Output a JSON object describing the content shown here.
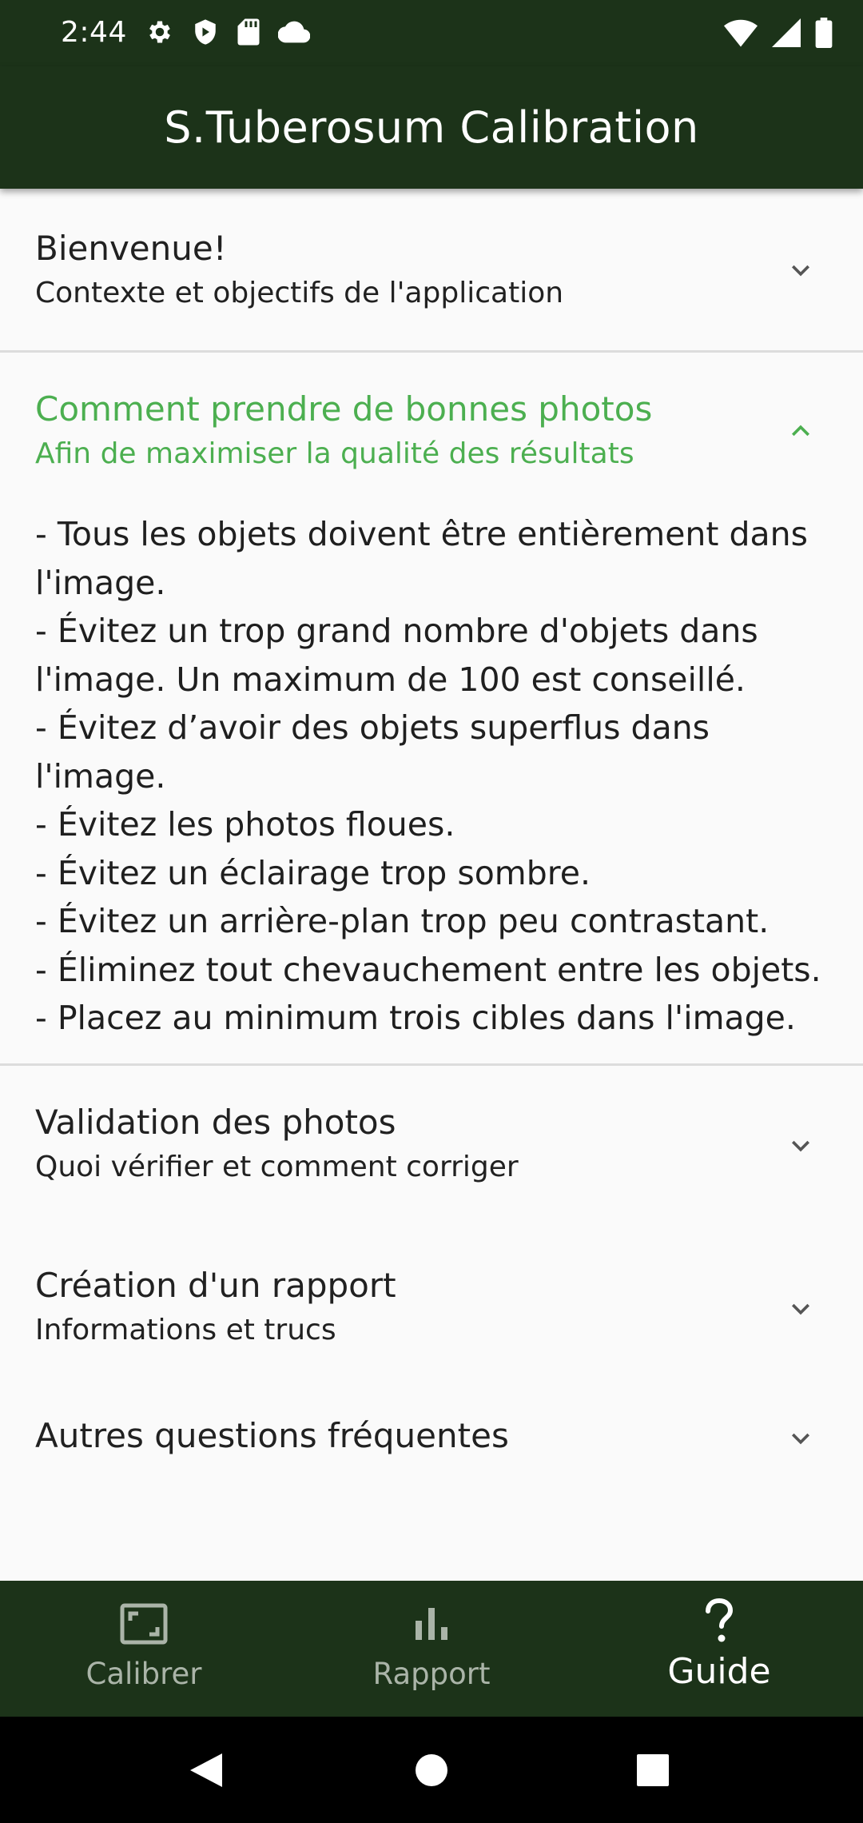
{
  "status_bar": {
    "time": "2:44",
    "left_icons": [
      "gear-icon",
      "shield-icon",
      "sd-card-icon",
      "cloud-icon"
    ],
    "right_icons": [
      "wifi-icon",
      "signal-icon",
      "battery-icon"
    ]
  },
  "app_bar": {
    "title": "S.Tuberosum Calibration"
  },
  "panels": [
    {
      "title": "Bienvenue!",
      "subtitle": "Contexte et objectifs de l'application",
      "expanded": false
    },
    {
      "title": "Comment prendre de bonnes photos",
      "subtitle": "Afin de maximiser la qualité des résultats",
      "expanded": true,
      "body": [
        "- Tous les objets doivent être entièrement dans l'image.",
        "- Évitez un trop grand nombre d'objets dans l'image. Un maximum de 100 est conseillé.",
        "- Évitez d’avoir des objets superflus dans l'image.",
        "- Évitez les photos floues.",
        "- Évitez un éclairage trop sombre.",
        "- Évitez un arrière-plan trop peu contrastant.",
        "- Éliminez tout chevauchement entre les objets.",
        "- Placez au minimum trois cibles dans l'image."
      ]
    },
    {
      "title": "Validation des photos",
      "subtitle": "Quoi vérifier et comment corriger",
      "expanded": false
    },
    {
      "title": "Création d'un rapport",
      "subtitle": "Informations et trucs",
      "expanded": false
    },
    {
      "title": "Autres questions fréquentes",
      "expanded": false
    }
  ],
  "bottom_nav": {
    "items": [
      {
        "label": "Calibrer",
        "icon": "crop-free-icon",
        "active": false
      },
      {
        "label": "Rapport",
        "icon": "bar-chart-icon",
        "active": false
      },
      {
        "label": "Guide",
        "icon": "question-mark-icon",
        "active": true
      }
    ]
  },
  "system_nav": {
    "icons": [
      "back-icon",
      "home-icon",
      "recents-icon"
    ]
  },
  "colors": {
    "primary_dark": "#1c3319",
    "accent_green": "#4caf50",
    "background": "#fafafa",
    "inactive_nav": "#aab4a8"
  }
}
